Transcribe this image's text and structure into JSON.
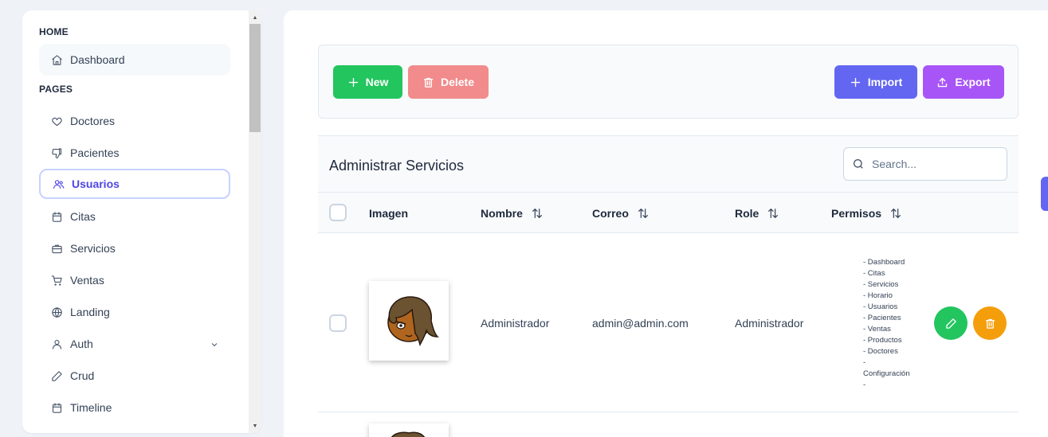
{
  "sidebar": {
    "sections": [
      {
        "title": "HOME"
      },
      {
        "title": "PAGES"
      }
    ],
    "items": [
      {
        "label": "Dashboard",
        "icon": "home-icon"
      },
      {
        "label": "Doctores",
        "icon": "heart-icon"
      },
      {
        "label": "Pacientes",
        "icon": "thumbs-down-icon"
      },
      {
        "label": "Usuarios",
        "icon": "users-icon",
        "active": true
      },
      {
        "label": "Citas",
        "icon": "calendar-icon"
      },
      {
        "label": "Servicios",
        "icon": "briefcase-icon"
      },
      {
        "label": "Ventas",
        "icon": "cart-icon"
      },
      {
        "label": "Landing",
        "icon": "globe-icon"
      },
      {
        "label": "Auth",
        "icon": "user-icon",
        "expandable": true
      },
      {
        "label": "Crud",
        "icon": "pencil-icon"
      },
      {
        "label": "Timeline",
        "icon": "calendar-icon"
      }
    ]
  },
  "toolbar": {
    "new_label": "New",
    "delete_label": "Delete",
    "import_label": "Import",
    "export_label": "Export"
  },
  "table": {
    "title": "Administrar Servicios",
    "search_placeholder": "Search...",
    "columns": [
      "Imagen",
      "Nombre",
      "Correo",
      "Role",
      "Permisos"
    ],
    "rows": [
      {
        "nombre": "Administrador",
        "correo": "admin@admin.com",
        "role": "Administrador",
        "permisos": [
          "- Dashboard",
          "- Citas",
          "- Servicios",
          "- Horario",
          "- Usuarios",
          "- Pacientes",
          "- Ventas",
          "- Productos",
          "- Doctores",
          "-",
          "Configuración",
          "-"
        ]
      }
    ]
  },
  "colors": {
    "new": "#22c55e",
    "delete": "#f28b8b",
    "import": "#6366f1",
    "export": "#a855f7",
    "edit": "#22c55e",
    "row_delete": "#f59e0b",
    "active": "#4f46e5"
  }
}
